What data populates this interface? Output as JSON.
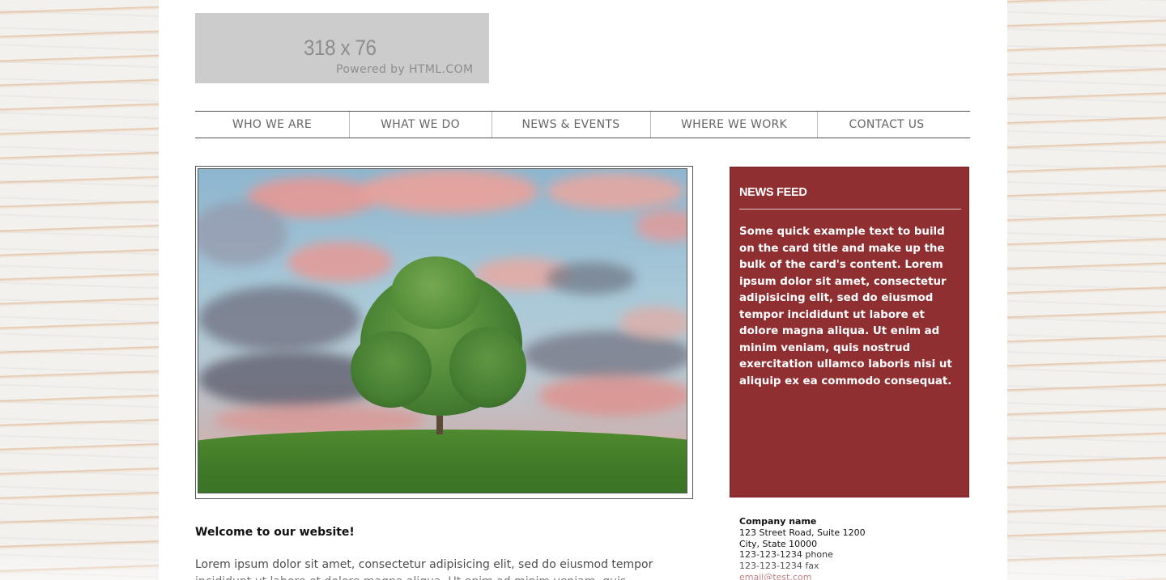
{
  "logo": {
    "size_text": "318 x 76",
    "powered_text": "Powered by HTML.COM"
  },
  "nav": {
    "items": [
      {
        "label": "WHO WE ARE"
      },
      {
        "label": "WHAT WE DO"
      },
      {
        "label": "NEWS & EVENTS"
      },
      {
        "label": "WHERE WE WORK"
      },
      {
        "label": "CONTACT US"
      }
    ]
  },
  "hero": {
    "subject": "tree-on-hill-under-cloudy-sky"
  },
  "newsfeed": {
    "title": "NEWS FEED",
    "body": "Some quick example text to build on the card title and make up the bulk of the card's content. Lorem ipsum dolor sit amet, consectetur adipisicing elit, sed do eiusmod tempor incididunt ut labore et dolore magna aliqua. Ut enim ad minim veniam, quis nostrud exercitation ullamco laboris nisi ut aliquip ex ea commodo consequat.",
    "background_color": "#902f32"
  },
  "welcome": {
    "title": "Welcome to our website!",
    "text": "Lorem ipsum dolor sit amet, consectetur adipisicing elit, sed do eiusmod tempor incididunt ut labore et dolore magna aliqua. Ut enim ad minim veniam, quis nostrud"
  },
  "contact": {
    "company": "Company name",
    "street": "123 Street Road, Suite 1200",
    "city": "City, State 10000",
    "phone": "123-123-1234 phone",
    "fax": "123-123-1234 fax",
    "email": "email@test.com"
  }
}
